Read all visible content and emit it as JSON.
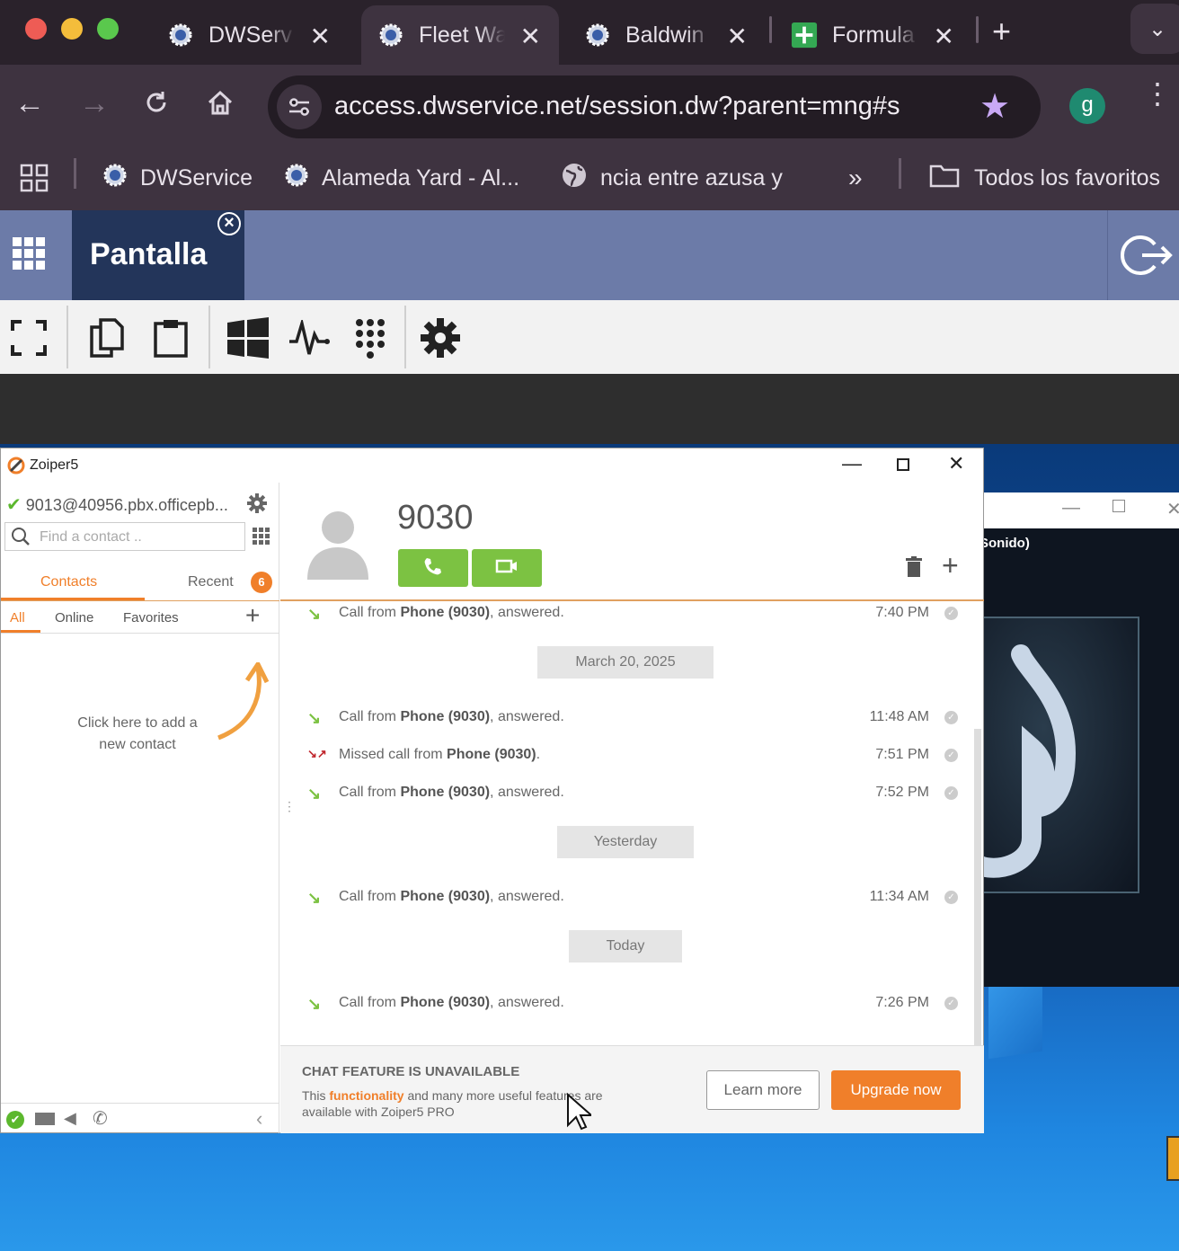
{
  "browser": {
    "tabs": [
      {
        "title": "DWServ",
        "active": false
      },
      {
        "title": "Fleet Wa",
        "active": true
      },
      {
        "title": "Baldwin",
        "active": false
      },
      {
        "title": "Formula",
        "active": false
      }
    ],
    "url": "access.dwservice.net/session.dw?parent=mng#s",
    "profile_initial": "g",
    "bookmarks": [
      "DWService",
      "Alameda Yard - Al...",
      "ncia entre azusa y"
    ],
    "all_bookmarks_label": "Todos los favoritos"
  },
  "dwservice": {
    "tab_label": "Pantalla"
  },
  "media_window": {
    "subtitle": "Sonido)"
  },
  "zoiper": {
    "window_title": "Zoiper5",
    "account": "9013@40956.pbx.officepb...",
    "search_placeholder": "Find a contact ..",
    "tabs": {
      "contacts": "Contacts",
      "recent": "Recent",
      "recent_badge": "6"
    },
    "filters": {
      "all": "All",
      "online": "Online",
      "favorites": "Favorites"
    },
    "add_contact_hint": "Click here to add a new contact",
    "contact_number": "9030",
    "history": [
      {
        "type": "answered",
        "prefix": "Call from ",
        "who": "Phone (9030)",
        "suffix": ", answered.",
        "time": "7:40 PM"
      },
      {
        "type": "date",
        "label": "March 20, 2025"
      },
      {
        "type": "answered",
        "prefix": "Call from ",
        "who": "Phone (9030)",
        "suffix": ", answered.",
        "time": "11:48 AM"
      },
      {
        "type": "missed",
        "prefix": "Missed call from ",
        "who": "Phone (9030)",
        "suffix": ".",
        "time": "7:51 PM"
      },
      {
        "type": "answered",
        "prefix": "Call from ",
        "who": "Phone (9030)",
        "suffix": ", answered.",
        "time": "7:52 PM"
      },
      {
        "type": "date",
        "label": "Yesterday"
      },
      {
        "type": "answered",
        "prefix": "Call from ",
        "who": "Phone (9030)",
        "suffix": ", answered.",
        "time": "11:34 AM"
      },
      {
        "type": "date",
        "label": "Today"
      },
      {
        "type": "answered",
        "prefix": "Call from ",
        "who": "Phone (9030)",
        "suffix": ", answered.",
        "time": "7:26 PM"
      }
    ],
    "chat": {
      "heading": "CHAT FEATURE IS UNAVAILABLE",
      "desc_pre": "This ",
      "desc_highlight": "functionality",
      "desc_post": " and many more useful features are available with Zoiper5 PRO",
      "learn_more": "Learn more",
      "upgrade": "Upgrade now"
    }
  },
  "colors": {
    "accent": "#f07f2a",
    "call_green": "#7cc242",
    "missed_red": "#c0272d"
  }
}
